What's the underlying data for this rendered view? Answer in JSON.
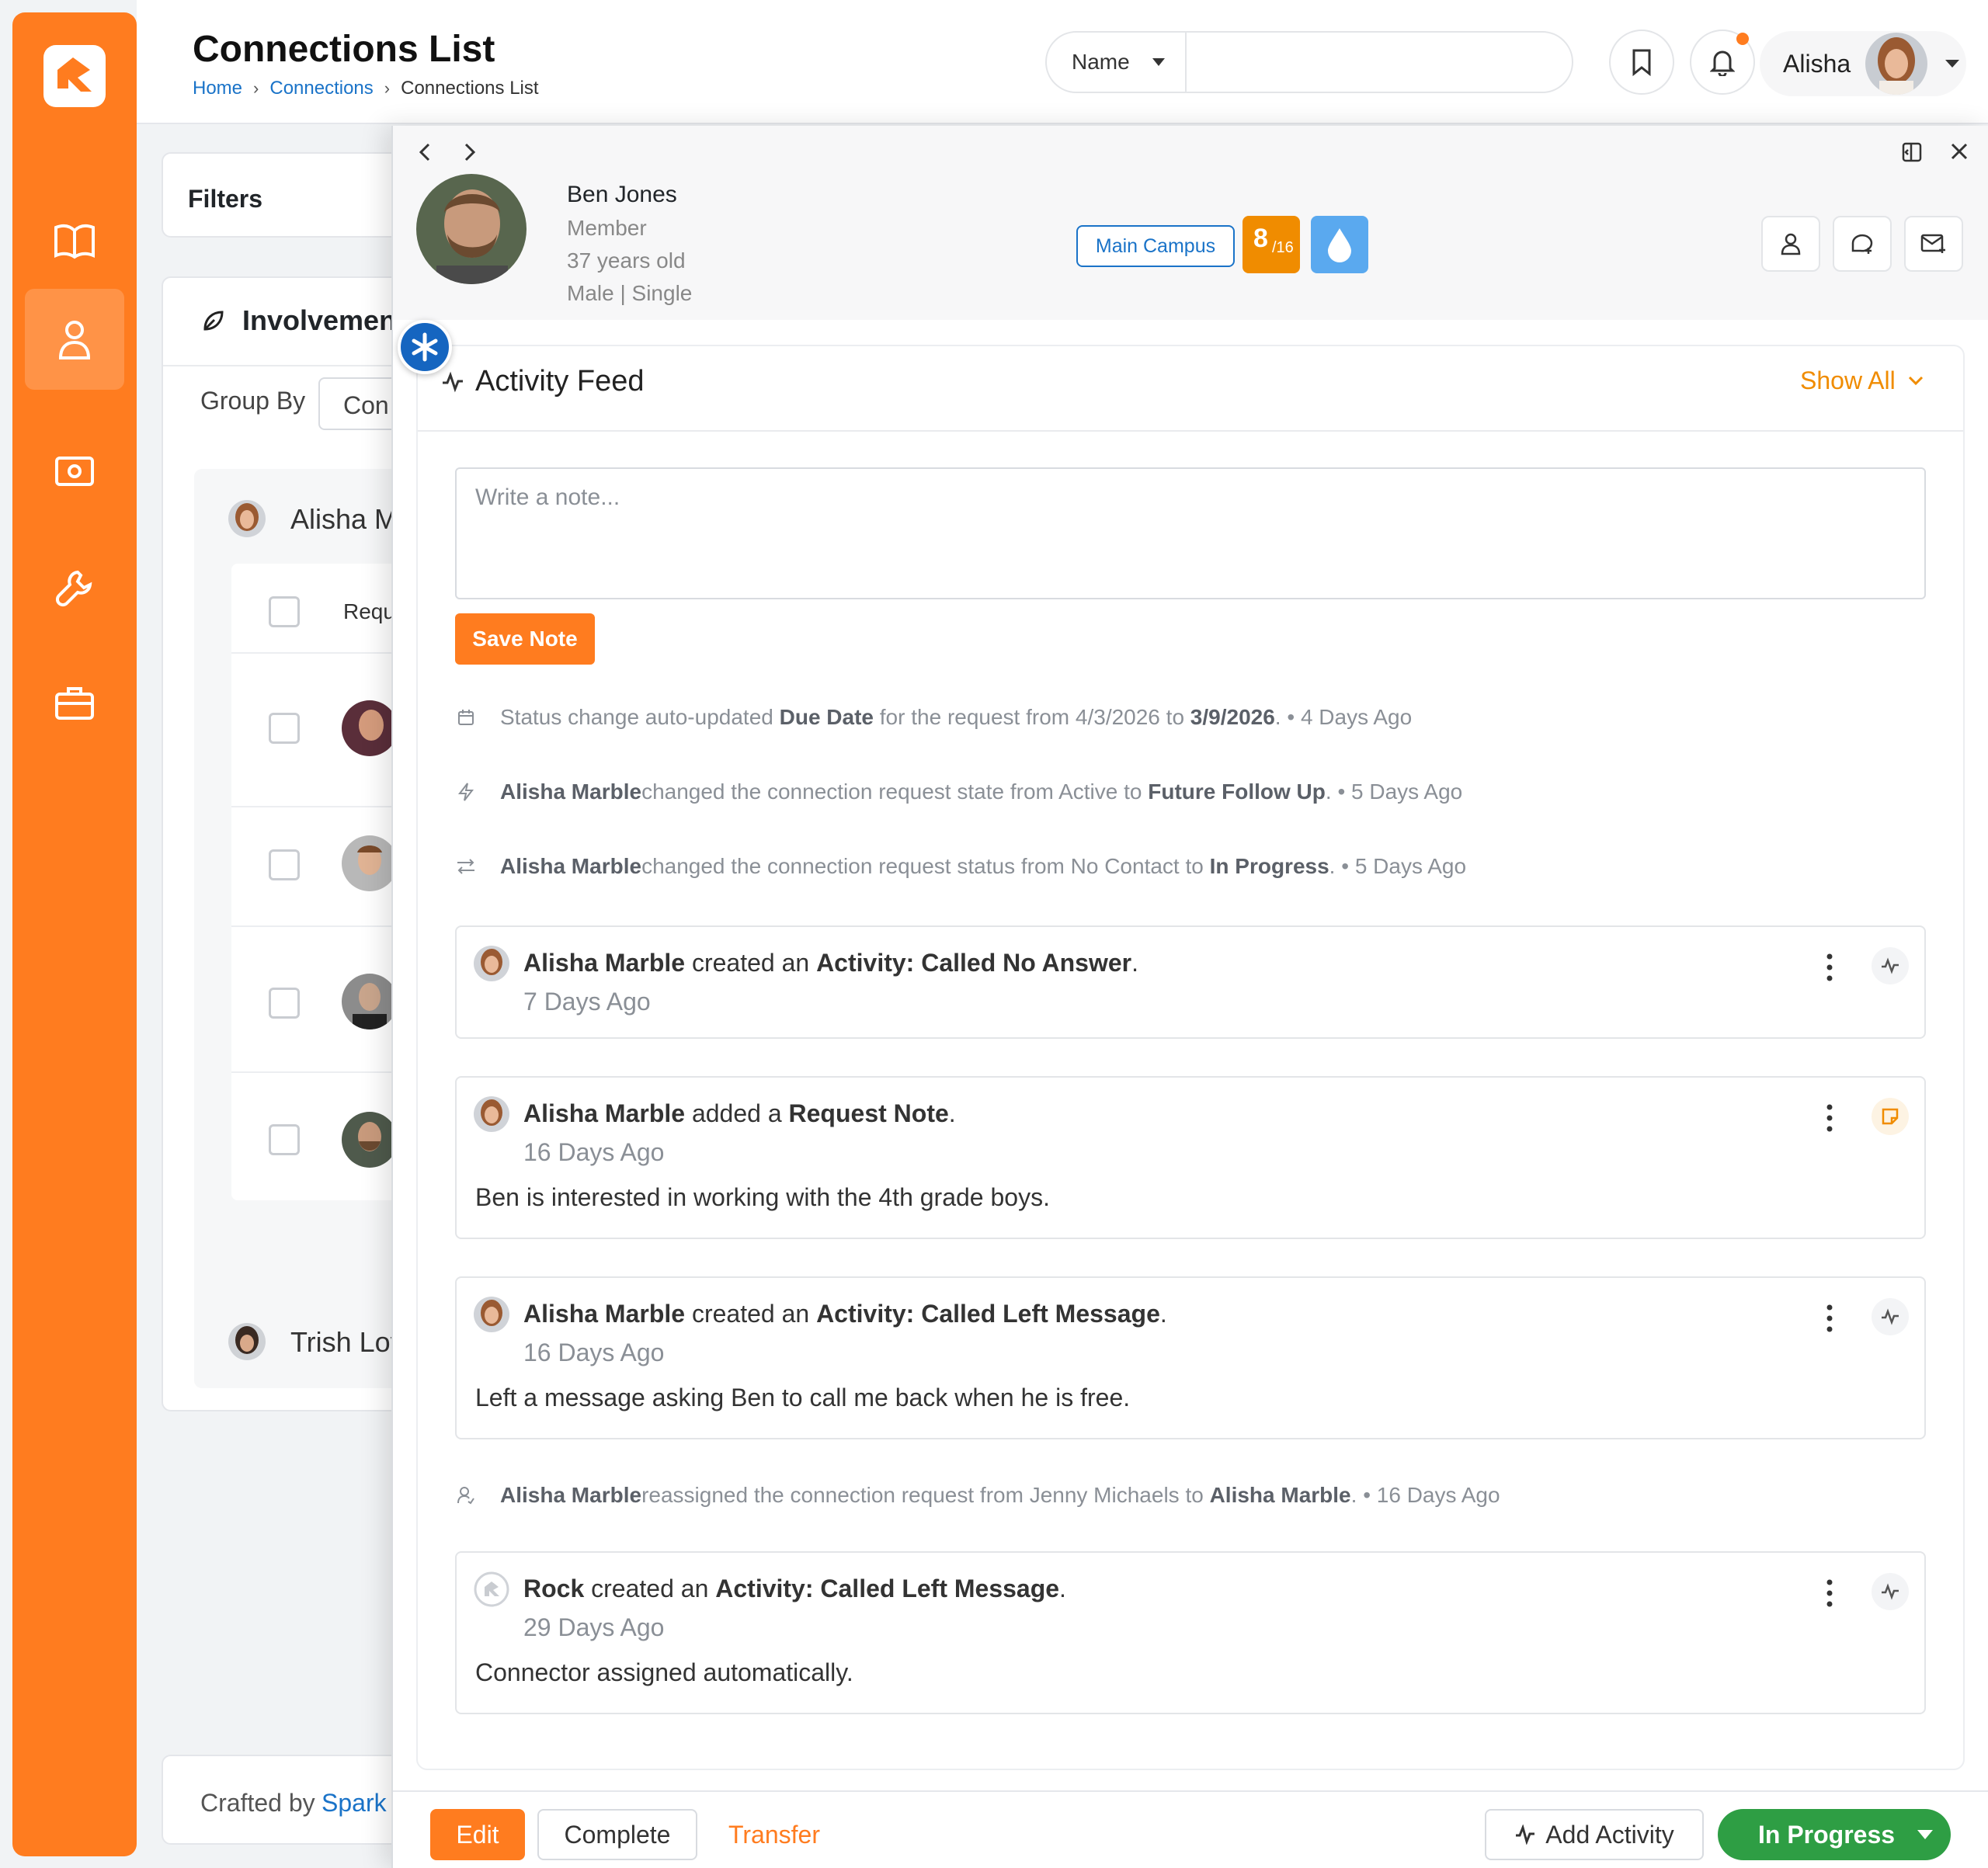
{
  "header": {
    "title": "Connections List",
    "breadcrumb": [
      "Home",
      "Connections",
      "Connections List"
    ],
    "search_type": "Name",
    "search_placeholder": "",
    "user_name": "Alisha"
  },
  "background": {
    "filters_label": "Filters",
    "involvement_label": "Involvemen",
    "group_by_label": "Group By",
    "group_by_value": "Con",
    "group1_name": "Alisha M",
    "col_header": "Requ",
    "group2_name": "Trish Lov",
    "footer_crafted": "Crafted by",
    "footer_link": "Spark"
  },
  "person": {
    "name": "Ben Jones",
    "role": "Member",
    "age": "37 years old",
    "gender_status": "Male | Single",
    "campus": "Main Campus",
    "score": "8",
    "score_total": "/16"
  },
  "feed": {
    "title": "Activity Feed",
    "show_all": "Show All",
    "note_placeholder": "Write a note...",
    "save_note": "Save Note",
    "sys1": {
      "pre": "Status change auto-updated ",
      "field": "Due Date",
      "mid": " for the request from 4/3/2026 to ",
      "to": "3/9/2026",
      "post": ". • 4 Days Ago"
    },
    "sys2": {
      "actor": "Alisha Marble",
      "mid": " changed the connection request state from Active to ",
      "to": "Future Follow Up",
      "post": ". • 5 Days Ago"
    },
    "sys3": {
      "actor": "Alisha Marble",
      "mid": " changed the connection request status from No Contact to ",
      "to": "In Progress",
      "post": ". • 5 Days Ago"
    },
    "act1": {
      "actor": "Alisha Marble",
      "verb": " created an ",
      "object": "Activity: Called No Answer",
      "end": ".",
      "when": "7 Days Ago"
    },
    "act2": {
      "actor": "Alisha Marble",
      "verb": " added a ",
      "object": "Request Note",
      "end": ".",
      "when": "16 Days Ago",
      "body": "Ben is interested in working with the 4th grade boys."
    },
    "act3": {
      "actor": "Alisha Marble",
      "verb": " created an ",
      "object": "Activity: Called Left Message",
      "end": ".",
      "when": "16 Days Ago",
      "body": "Left a message asking Ben to call me back when he is free."
    },
    "sys4": {
      "actor": "Alisha Marble",
      "mid": " reassigned the connection request from Jenny Michaels to ",
      "to": "Alisha Marble",
      "post": ". • 16 Days Ago"
    },
    "act4": {
      "actor": "Rock",
      "verb": " created an ",
      "object": "Activity: Called Left Message",
      "end": ".",
      "when": "29 Days Ago",
      "body": "Connector assigned automatically."
    }
  },
  "footer": {
    "edit": "Edit",
    "complete": "Complete",
    "transfer": "Transfer",
    "add_activity": "Add Activity",
    "status": "In Progress"
  },
  "colors": {
    "brand_orange": "#ff7c1f",
    "link_blue": "#1a73c8",
    "status_green": "#2e9e44"
  }
}
